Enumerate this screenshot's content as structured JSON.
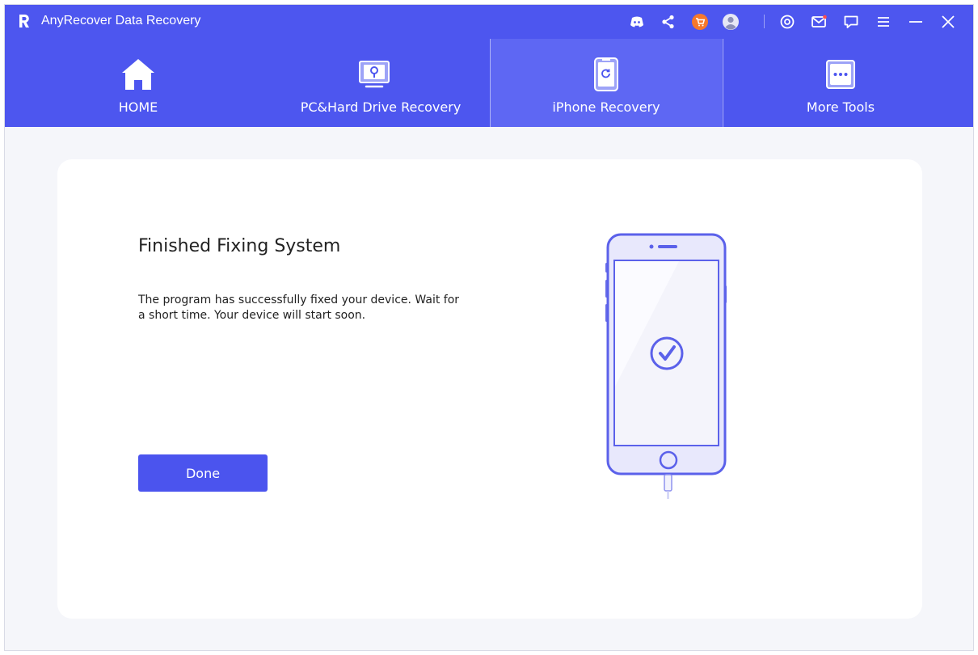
{
  "window": {
    "title": "AnyRecover Data Recovery"
  },
  "titlebar_icons": [
    "discord-icon",
    "share-icon",
    "cart-icon",
    "user-icon",
    "settings-icon",
    "mail-icon",
    "feedback-icon",
    "menu-icon",
    "minimize-icon",
    "close-icon"
  ],
  "tabs": [
    {
      "label": "HOME",
      "icon": "home-icon",
      "active": false
    },
    {
      "label": "PC&Hard Drive Recovery",
      "icon": "hard-drive-icon",
      "active": false
    },
    {
      "label": "iPhone Recovery",
      "icon": "iphone-icon",
      "active": true
    },
    {
      "label": "More Tools",
      "icon": "more-tools-icon",
      "active": false
    }
  ],
  "main": {
    "heading": "Finished Fixing System",
    "description": "The program has successfully fixed your device. Wait for a short time. Your device will start soon.",
    "done_label": "Done"
  },
  "colors": {
    "header": "#4d56ef",
    "active_tab": "#5e67f3",
    "primary_button": "#4b54ee",
    "cart_badge": "#f6782c"
  }
}
